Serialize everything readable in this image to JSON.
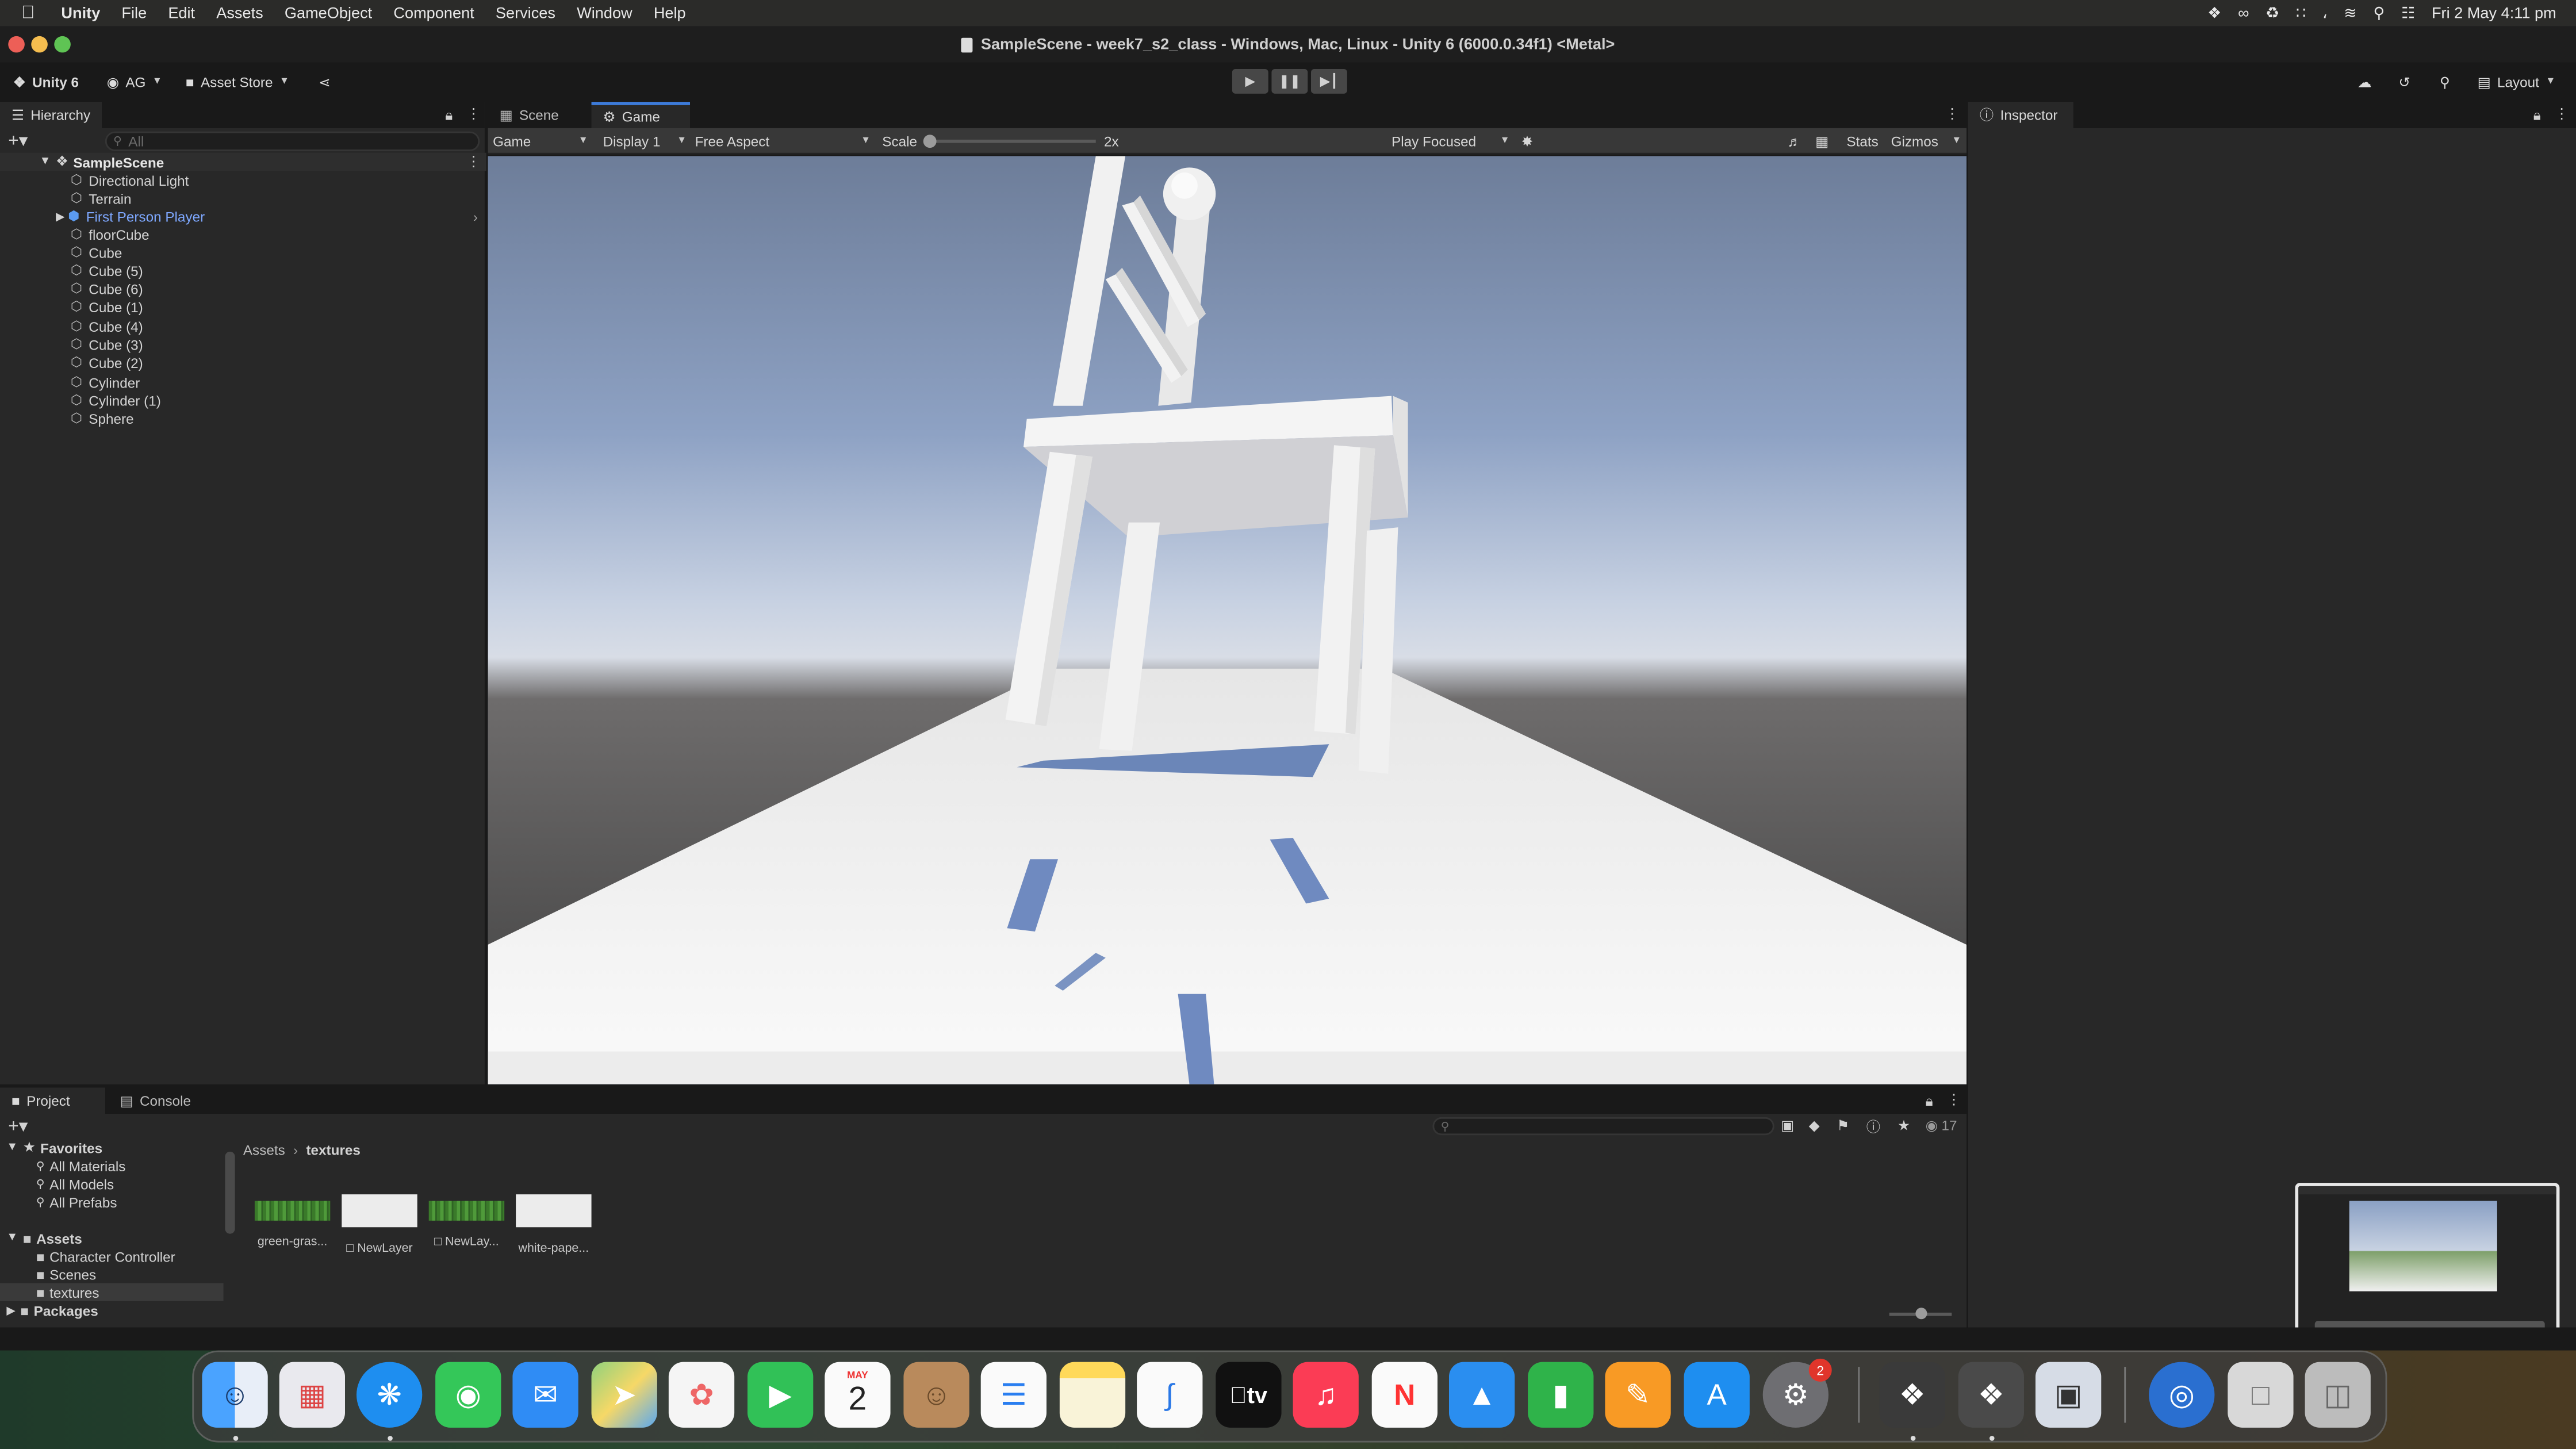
{
  "menubar": {
    "app": "Unity",
    "items": [
      "File",
      "Edit",
      "Assets",
      "GameObject",
      "Component",
      "Services",
      "Window",
      "Help"
    ],
    "datetime": "Fri 2 May  4:11 pm"
  },
  "window": {
    "title": "SampleScene - week7_s2_class - Windows, Mac, Linux - Unity 6 (6000.0.34f1) <Metal>"
  },
  "toolbar": {
    "unity_label": "Unity 6",
    "account": "AG",
    "asset_store": "Asset Store",
    "layout": "Layout"
  },
  "hierarchy": {
    "tab": "Hierarchy",
    "search_placeholder": "All",
    "scene": "SampleScene",
    "items": [
      "Directional Light",
      "Terrain",
      "First Person Player",
      "floorCube",
      "Cube",
      "Cube (5)",
      "Cube (6)",
      "Cube (1)",
      "Cube (4)",
      "Cube (3)",
      "Cube (2)",
      "Cylinder",
      "Cylinder (1)",
      "Sphere"
    ],
    "selected_item": "First Person Player"
  },
  "center": {
    "tabs": [
      "Scene",
      "Game"
    ],
    "active_tab": "Game"
  },
  "game_toolbar": {
    "mode": "Game",
    "display": "Display 1",
    "aspect": "Free Aspect",
    "scale_label": "Scale",
    "scale_value": "2x",
    "play_focused": "Play Focused",
    "stats": "Stats",
    "gizmos": "Gizmos"
  },
  "inspector": {
    "tab": "Inspector"
  },
  "project": {
    "tabs": [
      "Project",
      "Console"
    ],
    "count": "17",
    "favorites_label": "Favorites",
    "favorites": [
      "All Materials",
      "All Models",
      "All Prefabs"
    ],
    "assets_label": "Assets",
    "asset_folders": [
      "Character Controller",
      "Scenes",
      "textures"
    ],
    "packages_label": "Packages",
    "breadcrumb": [
      "Assets",
      "textures"
    ],
    "files": [
      "green-gras...",
      "NewLayer",
      "NewLay...",
      "white-pape..."
    ]
  },
  "dock": {
    "calendar_month": "MAY",
    "calendar_day": "2",
    "settings_badge": "2",
    "tv_label": "tv"
  },
  "colors": {
    "accent": "#3d7bd9",
    "selected_text": "#7ea8ff",
    "panel_bg": "#282828",
    "sky_top": "#6e7e9a",
    "horizon": "#555555",
    "floor": "#f2f2f2",
    "shadow": "#6f8cbf",
    "grass": "#3f7f2f",
    "badge_red": "#e0352b"
  }
}
